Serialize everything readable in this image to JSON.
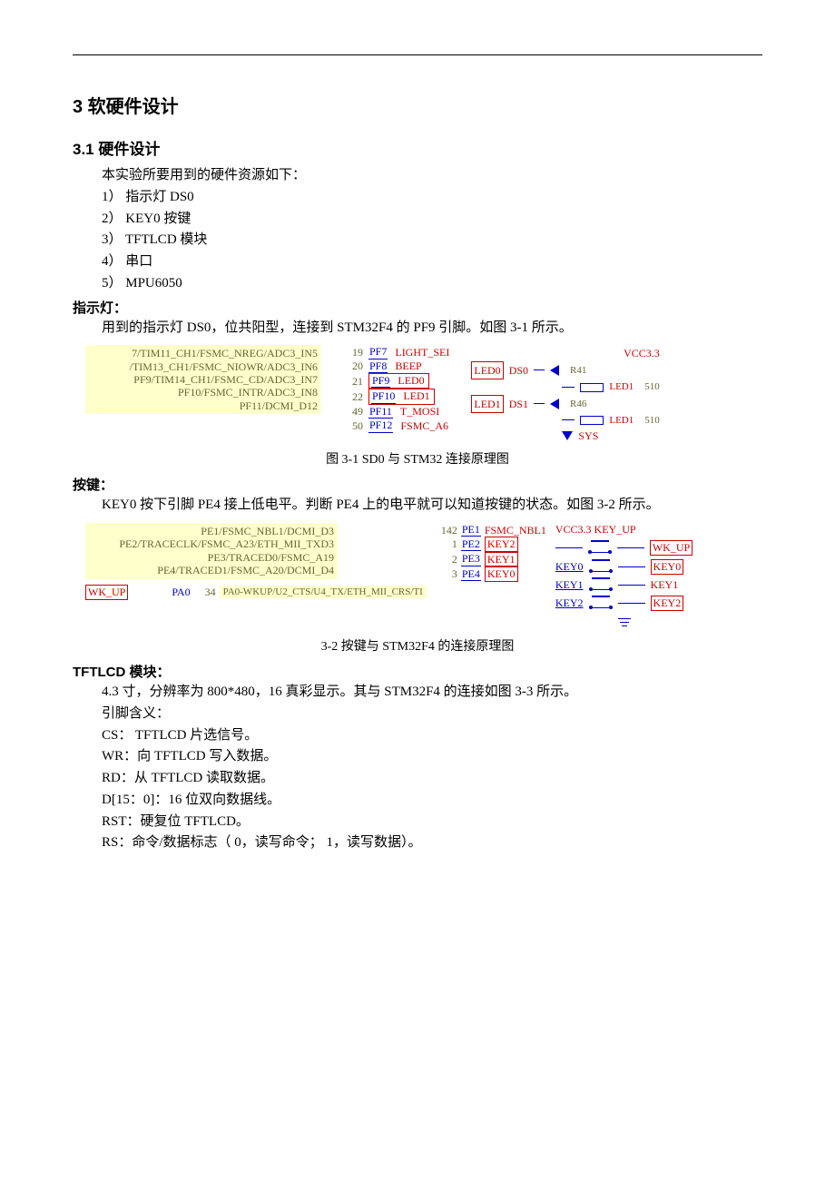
{
  "h_section": "3 软硬件设计",
  "h_31": "3.1 硬件设计",
  "intro_line": "本实验所要用到的硬件资源如下：",
  "list": {
    "i1": "1）  指示灯 DS0",
    "i2": "2）  KEY0 按键",
    "i3": "3）  TFTLCD  模块",
    "i4": "4）  串口",
    "i5": "5）  MPU6050"
  },
  "led": {
    "head": "指示灯：",
    "p1": "用到的指示灯 DS0，位共阳型，连接到 STM32F4 的 PF9 引脚。如图 3-1 所示。",
    "caption": "图 3-1 SD0 与 STM32 连接原理图",
    "yellow": {
      "r1": "7/TIM11_CH1/FSMC_NREG/ADC3_IN5",
      "r2": "/TIM13_CH1/FSMC_NIOWR/ADC3_IN6",
      "r3": "PF9/TIM14_CH1/FSMC_CD/ADC3_IN7",
      "r4": "PF10/FSMC_INTR/ADC3_IN8",
      "r5": "PF11/DCMI_D12"
    },
    "pins": {
      "n19": "19",
      "p7": "PF7",
      "l7": "LIGHT_SEI",
      "n20": "20",
      "p8": "PF8",
      "l8": "BEEP",
      "n21": "21",
      "p9": "PF9",
      "l9": "LED0",
      "n22": "22",
      "p10": "PF10",
      "l10": "LED1",
      "n49": "49",
      "p11": "PF11",
      "l11": "T_MOSI",
      "n50": "50",
      "p12": "PF12",
      "l12": "FSMC_A6"
    },
    "right": {
      "vcc": "VCC3.3",
      "led0": "LED0",
      "ds0": "DS0",
      "led1": "LED1",
      "ds1": "DS1",
      "r41": "R41",
      "r46": "R46",
      "v510a": "510",
      "v510b": "510",
      "ledname": "LED1",
      "sys": "SYS"
    }
  },
  "key": {
    "head": "按键：",
    "p1": "KEY0 按下引脚 PE4 接上低电平。判断 PE4 上的电平就可以知道按键的状态。如图 3-2 所示。",
    "caption": "3-2 按键与 STM32F4 的连接原理图",
    "yellow": {
      "r1": "PE1/FSMC_NBL1/DCMI_D3",
      "r2": "PE2/TRACECLK/FSMC_A23/ETH_MII_TXD3",
      "r3": "PE3/TRACED0/FSMC_A19",
      "r4": "PE4/TRACED1/FSMC_A20/DCMI_D4"
    },
    "pins": {
      "n142": "142",
      "pe1": "PE1",
      "fnbl": "FSMC_NBL1",
      "n1": "1",
      "pe2": "PE2",
      "k2": "KEY2",
      "n2": "2",
      "pe3": "PE3",
      "k1": "KEY1",
      "n3": "3",
      "pe4": "PE4",
      "k0": "KEY0"
    },
    "wk": {
      "tag": "WK_UP",
      "pa0": "PA0",
      "n34": "34",
      "desc": "PA0-WKUP/U2_CTS/U4_TX/ETH_MII_CRS/TI"
    },
    "sch": {
      "hdr": "VCC3.3  KEY_UP",
      "wkup": "WK_UP",
      "key0": "KEY0",
      "key1": "KEY1",
      "key2": "KEY2",
      "ukey0": "KEY0",
      "ukey1": "KEY1",
      "ukey2": "KEY2"
    }
  },
  "tft": {
    "head": "TFTLCD  模块：",
    "p1": "4.3 寸，分辨率为 800*480，16 真彩显示。其与 STM32F4 的连接如图 3-3 所示。",
    "p2": "引脚含义：",
    "p3": "CS：  TFTLCD  片选信号。",
    "p4": "WR：向 TFTLCD  写入数据。",
    "p5": "RD：从 TFTLCD  读取数据。",
    "p6": "D[15：0]：16 位双向数据线。",
    "p7": "RST：硬复位 TFTLCD。",
    "p8": "RS：命令/数据标志（ 0，读写命令； 1，读写数据）。"
  }
}
